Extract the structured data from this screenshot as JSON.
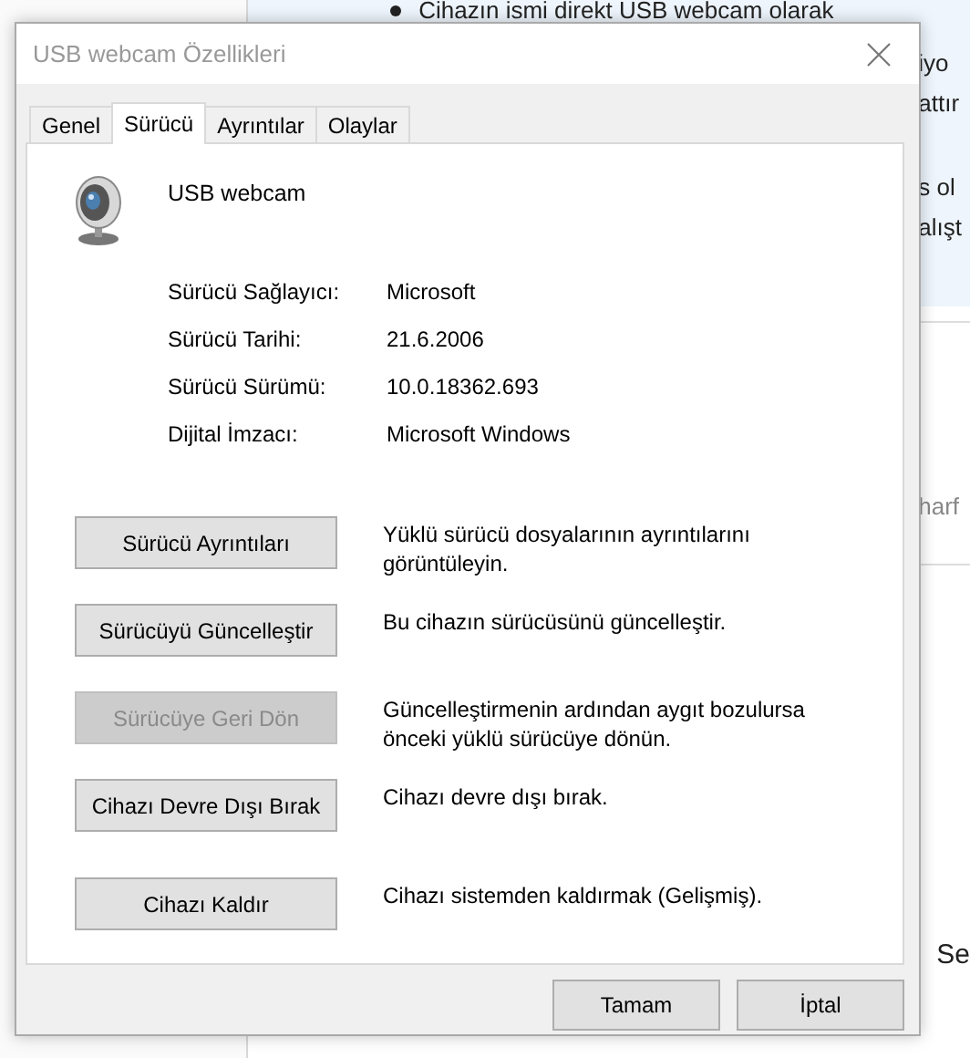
{
  "background": {
    "bullet_text": "Cihazın ismi direkt USB webcam olarak",
    "paragraphs": [
      [
        "iyo",
        "attır"
      ],
      [
        "s ol",
        "alışt"
      ]
    ],
    "card_text": "harf",
    "footer_text": "Se"
  },
  "window": {
    "title": "USB webcam Özellikleri"
  },
  "tabs": [
    {
      "label": "Genel",
      "selected": false
    },
    {
      "label": "Sürücü",
      "selected": true
    },
    {
      "label": "Ayrıntılar",
      "selected": false
    },
    {
      "label": "Olaylar",
      "selected": false
    }
  ],
  "device": {
    "name": "USB webcam"
  },
  "properties": [
    {
      "label": "Sürücü Sağlayıcı:",
      "value": "Microsoft"
    },
    {
      "label": "Sürücü Tarihi:",
      "value": "21.6.2006"
    },
    {
      "label": "Sürücü Sürümü:",
      "value": "10.0.18362.693"
    },
    {
      "label": "Dijital İmzacı:",
      "value": "Microsoft Windows"
    }
  ],
  "actions": [
    {
      "button": "Sürücü Ayrıntıları",
      "description": "Yüklü sürücü dosyalarının ayrıntılarını görüntüleyin.",
      "disabled": false
    },
    {
      "button": "Sürücüyü Güncelleştir",
      "description": "Bu cihazın sürücüsünü güncelleştir.",
      "disabled": false
    },
    {
      "button": "Sürücüye Geri Dön",
      "description": "Güncelleştirmenin ardından aygıt bozulursa önceki yüklü sürücüye dönün.",
      "disabled": true
    },
    {
      "button": "Cihazı Devre Dışı Bırak",
      "description": "Cihazı devre dışı bırak.",
      "disabled": false
    },
    {
      "button": "Cihazı Kaldır",
      "description": "Cihazı sistemden kaldırmak (Gelişmiş).",
      "disabled": false
    }
  ],
  "footer_buttons": [
    "Tamam",
    "İptal"
  ]
}
